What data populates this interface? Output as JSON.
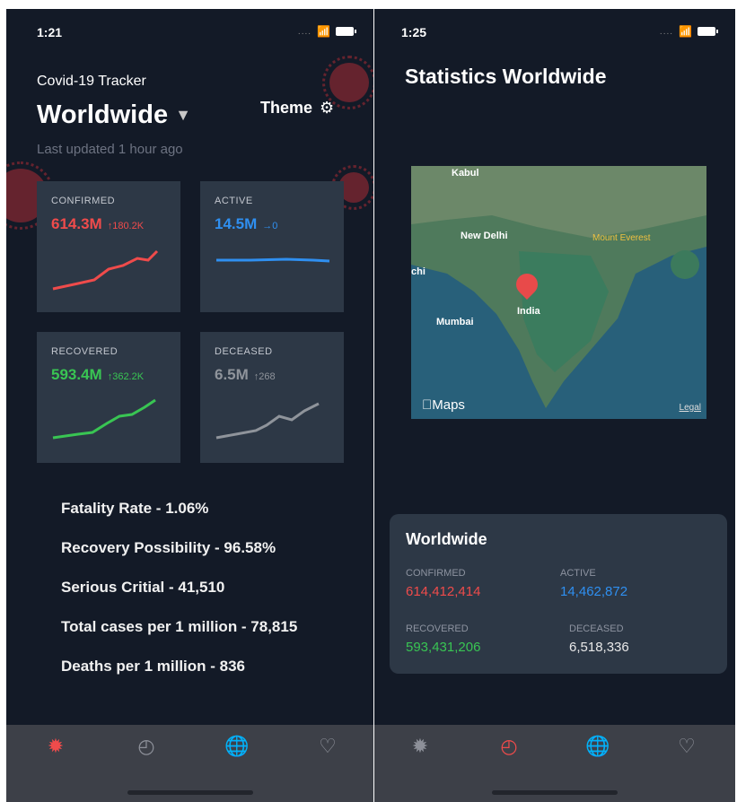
{
  "left_screen": {
    "status_time": "1:21",
    "app_title": "Covid-19 Tracker",
    "region": "Worldwide",
    "theme_label": "Theme",
    "last_updated": "Last updated 1 hour ago",
    "cards": [
      {
        "label": "CONFIRMED",
        "value": "614.3M",
        "delta": "↑180.2K",
        "color": "#ef4b4b"
      },
      {
        "label": "ACTIVE",
        "value": "14.5M",
        "delta": "→0",
        "color": "#2f8ff0"
      },
      {
        "label": "RECOVERED",
        "value": "593.4M",
        "delta": "↑362.2K",
        "color": "#39c553"
      },
      {
        "label": "DECEASED",
        "value": "6.5M",
        "delta": "↑268",
        "color": "#8f949b"
      }
    ],
    "stats": [
      "Fatality Rate - 1.06%",
      "Recovery Possibility - 96.58%",
      "Serious Critial - 41,510",
      "Total cases per 1 million - 78,815",
      "Deaths per 1 million - 836"
    ],
    "tabs": {
      "active_color": "#ef4b4b",
      "inactive_color": "#8d9099"
    }
  },
  "right_screen": {
    "status_time": "1:25",
    "title": "Statistics Worldwide",
    "map": {
      "labels": [
        "Kabul",
        "New Delhi",
        "Mount Everest",
        "chi",
        "India",
        "Mumbai"
      ],
      "brand": "Maps",
      "legal": "Legal"
    },
    "panel": {
      "title": "Worldwide",
      "confirmed_label": "CONFIRMED",
      "confirmed_value": "614,412,414",
      "active_label": "ACTIVE",
      "active_value": "14,462,872",
      "recovered_label": "RECOVERED",
      "recovered_value": "593,431,206",
      "deceased_label": "DECEASED",
      "deceased_value": "6,518,336"
    }
  },
  "colors": {
    "background": "#131a27",
    "card": "#2d3846",
    "confirmed": "#ef4b4b",
    "active": "#2f8ff0",
    "recovered": "#39c553",
    "deceased": "#8f949b"
  }
}
